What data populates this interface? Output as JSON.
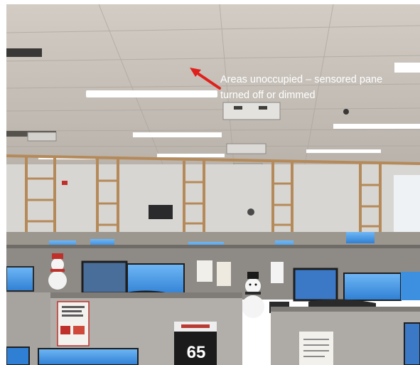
{
  "annotation": {
    "line1": "Areas unoccupied – sensored pane",
    "line2": "turned off or dimmed",
    "arrow_color": "#e0201c"
  },
  "signage": {
    "cubicle_number": "65"
  },
  "colors": {
    "ceiling": "#c9c3bb",
    "partition_gray": "#8e8b86",
    "wood_frame": "#b58a5a",
    "monitor_blue": "#3d8fe0"
  }
}
